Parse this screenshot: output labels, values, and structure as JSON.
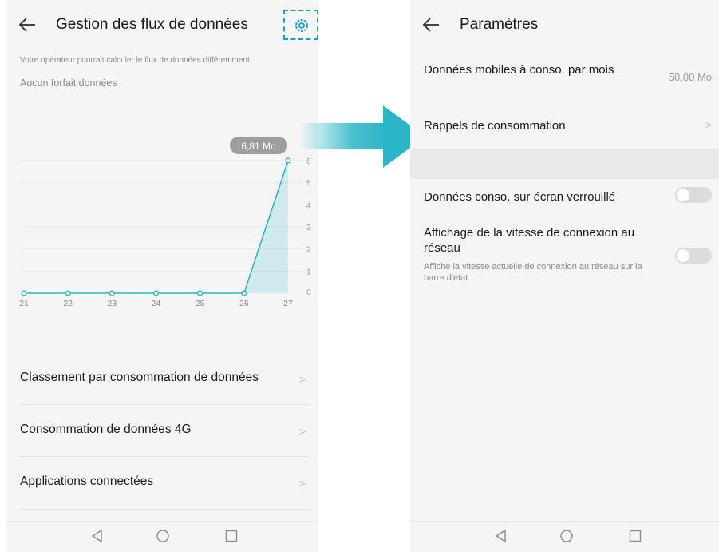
{
  "left": {
    "title": "Gestion des flux de données",
    "operator_note": "Votre opérateur pourrait calculer le flux de données différemment.",
    "plan_note": "Aucun forfait données",
    "tooltip": "6,81 Mo",
    "menu": [
      {
        "label": "Classement par consommation de données",
        "chevron": ">"
      },
      {
        "label": "Consommation de données 4G",
        "chevron": ">"
      },
      {
        "label": "Applications connectées",
        "chevron": ">"
      }
    ]
  },
  "right": {
    "title": "Paramètres",
    "monthly": {
      "label": "Données mobiles à conso. par mois",
      "value": "50,00 Mo"
    },
    "reminders": {
      "label": "Rappels de consommation",
      "chevron": ">"
    },
    "lock_screen": {
      "label": "Données conso. sur écran verrouillé",
      "enabled": false
    },
    "speed": {
      "label": "Affichage de la vitesse de connexion au réseau",
      "desc": "Affiche la vitesse actuelle de connexion au réseau sur la barre d'état",
      "enabled": false
    }
  },
  "colors": {
    "accent": "#2bb5c8",
    "toggle_off": "#dcdcdc"
  },
  "chart_data": {
    "type": "area",
    "x": [
      "21",
      "22",
      "23",
      "24",
      "25",
      "26",
      "27"
    ],
    "y": [
      0,
      0,
      0,
      0,
      0,
      0,
      6
    ],
    "yticks": [
      "0",
      "1",
      "2",
      "3",
      "4",
      "5",
      "6"
    ],
    "ylim": [
      0,
      6
    ],
    "annotation": "6,81 Mo"
  }
}
